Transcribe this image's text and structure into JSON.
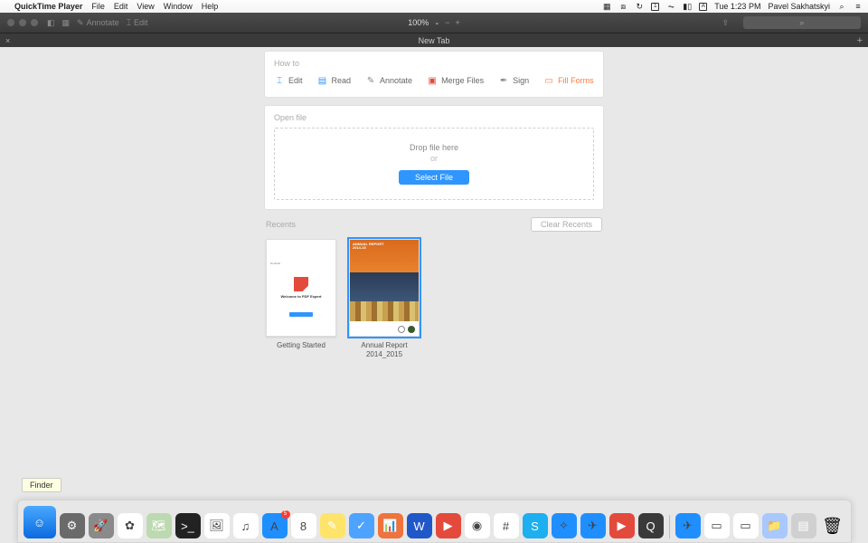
{
  "menubar": {
    "app": "QuickTime Player",
    "items": [
      "File",
      "Edit",
      "View",
      "Window",
      "Help"
    ],
    "clock": "Tue 1:23 PM",
    "user": "Pavel Sakhatskyi"
  },
  "toolbar": {
    "annotate": "Annotate",
    "edit": "Edit",
    "zoom": "100%",
    "search_placeholder": "⌕"
  },
  "tab": {
    "title": "New Tab",
    "close": "×",
    "add": "+"
  },
  "howto": {
    "title": "How to",
    "items": [
      {
        "label": "Edit",
        "icon": "⌶",
        "color": "#2f95ff"
      },
      {
        "label": "Read",
        "icon": "▤",
        "color": "#2f95ff"
      },
      {
        "label": "Annotate",
        "icon": "✎",
        "color": "#888"
      },
      {
        "label": "Merge Files",
        "icon": "▣",
        "color": "#e34a3c"
      },
      {
        "label": "Sign",
        "icon": "✒",
        "color": "#888"
      },
      {
        "label": "Fill Forms",
        "icon": "▭",
        "color": "#ff7a3d",
        "accent": true
      }
    ]
  },
  "openfile": {
    "title": "Open file",
    "drop": "Drop file here",
    "or": "or",
    "button": "Select File"
  },
  "recents": {
    "title": "Recents",
    "clear": "Clear Recents",
    "items": [
      {
        "label": "Getting Started"
      },
      {
        "label": "Annual Report 2014_2015",
        "selected": true
      }
    ]
  },
  "ar_text": "ANNUAL REPORT\n2014-15",
  "gs_text": "Welcome to PDF Expert",
  "tooltip": "Finder",
  "dock": [
    {
      "name": "finder",
      "bg": "linear-gradient(#4aa8ff,#0a6adf)",
      "glyph": "☺",
      "large": true
    },
    {
      "name": "settings",
      "bg": "#6a6a6a",
      "glyph": "⚙"
    },
    {
      "name": "launchpad",
      "bg": "#8a8a8a",
      "glyph": "🚀"
    },
    {
      "name": "photos",
      "bg": "#fff",
      "glyph": "✿"
    },
    {
      "name": "maps",
      "bg": "#bcd9b0",
      "glyph": "🗺"
    },
    {
      "name": "terminal",
      "bg": "#222",
      "glyph": ">_"
    },
    {
      "name": "preview",
      "bg": "#fff",
      "glyph": "🖼"
    },
    {
      "name": "itunes",
      "bg": "#fff",
      "glyph": "♫"
    },
    {
      "name": "appstore",
      "bg": "#1f8fff",
      "glyph": "A",
      "badge": "5"
    },
    {
      "name": "calendar",
      "bg": "#fff",
      "glyph": "8"
    },
    {
      "name": "notes",
      "bg": "#ffe46b",
      "glyph": "✎"
    },
    {
      "name": "todo",
      "bg": "#4da3ff",
      "glyph": "✓"
    },
    {
      "name": "keynote",
      "bg": "#f0723c",
      "glyph": "📊"
    },
    {
      "name": "word",
      "bg": "#2058c9",
      "glyph": "W"
    },
    {
      "name": "pdfexpert",
      "bg": "#e34a3c",
      "glyph": "▶"
    },
    {
      "name": "chrome",
      "bg": "#fff",
      "glyph": "◉"
    },
    {
      "name": "slack",
      "bg": "#fff",
      "glyph": "#"
    },
    {
      "name": "skype",
      "bg": "#1daff0",
      "glyph": "S"
    },
    {
      "name": "safari",
      "bg": "#1f8fff",
      "glyph": "✧"
    },
    {
      "name": "spark",
      "bg": "#1f8fff",
      "glyph": "✈"
    },
    {
      "name": "pdf2",
      "bg": "#e34a3c",
      "glyph": "▶"
    },
    {
      "name": "quicktime",
      "bg": "#3a3a3a",
      "glyph": "Q"
    }
  ],
  "dock_right": [
    {
      "name": "spark2",
      "bg": "#1f8fff",
      "glyph": "✈"
    },
    {
      "name": "file1",
      "bg": "#fff",
      "glyph": "▭"
    },
    {
      "name": "file2",
      "bg": "#fff",
      "glyph": "▭"
    },
    {
      "name": "folder",
      "bg": "#a8c8ff",
      "glyph": "📁"
    },
    {
      "name": "stack",
      "bg": "#d0d0d0",
      "glyph": "▤"
    }
  ]
}
